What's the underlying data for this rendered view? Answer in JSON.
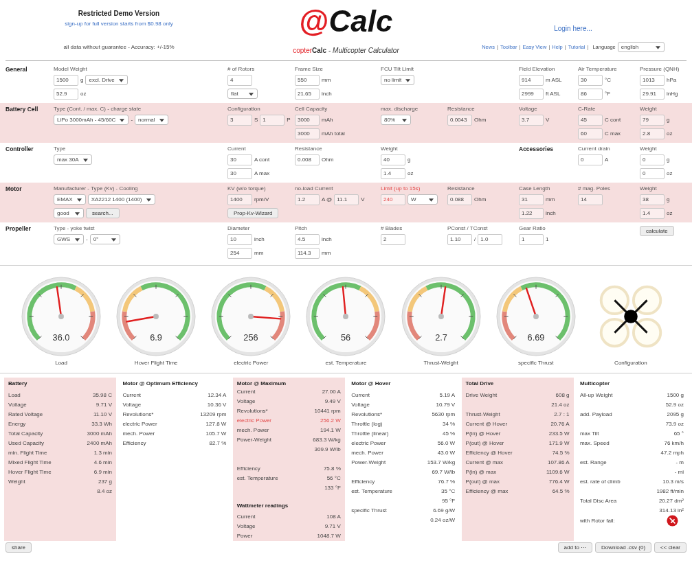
{
  "header": {
    "demo_title": "Restricted Demo Version",
    "signup": "sign-up for full version starts from $0.98 only",
    "disclaimer": "all data without guarantee - Accuracy: +/-15%",
    "logo_mark": "@",
    "logo_text": "Calc",
    "subtitle_prefix": "copter",
    "subtitle": "**Calc** - *Multicopter Calculator*",
    "login": "Login here...",
    "links": [
      "News",
      "Toolbar",
      "Easy View",
      "Help",
      "Tutorial"
    ],
    "separator": "|",
    "language_label": "Language",
    "language": "english"
  },
  "inputs": [
    {
      "title": "General",
      "shaded": false,
      "groups": [
        {
          "kind": "field",
          "label": "Model Weight",
          "lines": [
            [
              {
                "kind": "input",
                "text": "1500"
              },
              {
                "kind": "unit",
                "text": "g"
              },
              {
                "kind": "select",
                "text": "excl. Drive"
              }
            ],
            [
              {
                "kind": "input",
                "text": "52.9"
              },
              {
                "kind": "unit",
                "text": "oz"
              }
            ]
          ]
        },
        {
          "kind": "field",
          "label": "# of Rotors",
          "lines": [
            [
              {
                "kind": "input",
                "text": "4"
              }
            ],
            [
              {
                "kind": "select",
                "text": "flat"
              }
            ]
          ]
        },
        {
          "kind": "field",
          "label": "Frame Size",
          "lines": [
            [
              {
                "kind": "input",
                "text": "550"
              },
              {
                "kind": "unit",
                "text": "mm"
              }
            ],
            [
              {
                "kind": "input",
                "text": "21.65"
              },
              {
                "kind": "unit",
                "text": "inch"
              }
            ]
          ]
        },
        {
          "kind": "field",
          "label": "FCU Tilt Limit",
          "lines": [
            [
              {
                "kind": "select",
                "text": "no limit"
              }
            ]
          ]
        },
        {
          "kind": "field",
          "label": "Field Elevation",
          "lines": [
            [
              {
                "kind": "input",
                "text": "914"
              },
              {
                "kind": "unit",
                "text": "m ASL"
              }
            ],
            [
              {
                "kind": "input",
                "text": "2999"
              },
              {
                "kind": "unit",
                "text": "ft ASL"
              }
            ]
          ]
        },
        {
          "kind": "field",
          "label": "Air Temperature",
          "lines": [
            [
              {
                "kind": "input",
                "text": "30"
              },
              {
                "kind": "unit",
                "text": "°C"
              }
            ],
            [
              {
                "kind": "input",
                "text": "86"
              },
              {
                "kind": "unit",
                "text": "°F"
              }
            ]
          ]
        },
        {
          "kind": "field",
          "label": "Pressure (QNH)",
          "lines": [
            [
              {
                "kind": "input",
                "text": "1013"
              },
              {
                "kind": "unit",
                "text": "hPa"
              }
            ],
            [
              {
                "kind": "input",
                "text": "29.91"
              },
              {
                "kind": "unit",
                "text": "inHg"
              }
            ]
          ]
        }
      ]
    },
    {
      "title": "Battery Cell",
      "shaded": true,
      "groups": [
        {
          "kind": "field",
          "label": "Type (Cont. / max. C) - charge state",
          "lines": [
            [
              {
                "kind": "select",
                "text": "LiPo 3000mAh - 45/60C"
              },
              {
                "kind": "unit",
                "text": "-"
              },
              {
                "kind": "select",
                "text": "normal"
              }
            ]
          ]
        },
        {
          "kind": "field",
          "label": "Configuration",
          "lines": [
            [
              {
                "kind": "input",
                "text": "3"
              },
              {
                "kind": "unit",
                "text": "S"
              },
              {
                "kind": "input",
                "text": "1"
              },
              {
                "kind": "unit",
                "text": "P"
              }
            ]
          ]
        },
        {
          "kind": "field",
          "label": "Cell Capacity",
          "lines": [
            [
              {
                "kind": "input",
                "text": "3000"
              },
              {
                "kind": "unit",
                "text": "mAh"
              }
            ],
            [
              {
                "kind": "input",
                "text": "3000"
              },
              {
                "kind": "unit",
                "text": "mAh total"
              }
            ]
          ]
        },
        {
          "kind": "field",
          "label": "max. discharge",
          "lines": [
            [
              {
                "kind": "select",
                "text": "80%"
              }
            ]
          ]
        },
        {
          "kind": "field",
          "label": "Resistance",
          "lines": [
            [
              {
                "kind": "input",
                "text": "0.0043"
              },
              {
                "kind": "unit",
                "text": "Ohm"
              }
            ]
          ]
        },
        {
          "kind": "field",
          "label": "Voltage",
          "lines": [
            [
              {
                "kind": "input",
                "text": "3.7"
              },
              {
                "kind": "unit",
                "text": "V"
              }
            ]
          ]
        },
        {
          "kind": "field",
          "label": "C-Rate",
          "lines": [
            [
              {
                "kind": "input",
                "text": "45"
              },
              {
                "kind": "unit",
                "text": "C cont"
              }
            ],
            [
              {
                "kind": "input",
                "text": "60"
              },
              {
                "kind": "unit",
                "text": "C max"
              }
            ]
          ]
        },
        {
          "kind": "field",
          "label": "Weight",
          "lines": [
            [
              {
                "kind": "input",
                "text": "79"
              },
              {
                "kind": "unit",
                "text": "g"
              }
            ],
            [
              {
                "kind": "input",
                "text": "2.8"
              },
              {
                "kind": "unit",
                "text": "oz"
              }
            ]
          ]
        }
      ]
    },
    {
      "title": "Controller",
      "shaded": false,
      "groups": [
        {
          "kind": "field",
          "label": "Type",
          "lines": [
            [
              {
                "kind": "select",
                "text": "max 30A"
              }
            ]
          ]
        },
        {
          "kind": "field",
          "label": "Current",
          "lines": [
            [
              {
                "kind": "input",
                "text": "30"
              },
              {
                "kind": "unit",
                "text": "A cont"
              }
            ],
            [
              {
                "kind": "input",
                "text": "30"
              },
              {
                "kind": "unit",
                "text": "A max"
              }
            ]
          ]
        },
        {
          "kind": "field",
          "label": "Resistance",
          "lines": [
            [
              {
                "kind": "input",
                "text": "0.008"
              },
              {
                "kind": "unit",
                "text": "Ohm"
              }
            ]
          ]
        },
        {
          "kind": "field",
          "label": "Weight",
          "lines": [
            [
              {
                "kind": "input",
                "text": "40"
              },
              {
                "kind": "unit",
                "text": "g"
              }
            ],
            [
              {
                "kind": "input",
                "text": "1.4"
              },
              {
                "kind": "unit",
                "text": "oz"
              }
            ]
          ]
        },
        {
          "kind": "heading",
          "label": "Accessories"
        },
        {
          "kind": "field",
          "label": "Current drain",
          "lines": [
            [
              {
                "kind": "input",
                "text": "0"
              },
              {
                "kind": "unit",
                "text": "A"
              }
            ]
          ]
        },
        {
          "kind": "field",
          "label": "Weight",
          "lines": [
            [
              {
                "kind": "input",
                "text": "0"
              },
              {
                "kind": "unit",
                "text": "g"
              }
            ],
            [
              {
                "kind": "input",
                "text": "0"
              },
              {
                "kind": "unit",
                "text": "oz"
              }
            ]
          ]
        }
      ]
    },
    {
      "title": "Motor",
      "shaded": true,
      "groups": [
        {
          "kind": "field",
          "label": "Manufacturer - Type (Kv) - Cooling",
          "lines": [
            [
              {
                "kind": "select",
                "text": "EMAX"
              },
              {
                "kind": "select",
                "text": "XA2212 1400 (1400)"
              }
            ],
            [
              {
                "kind": "select",
                "text": "good"
              },
              {
                "kind": "button",
                "text": "search..."
              }
            ]
          ]
        },
        {
          "kind": "field",
          "label": "KV (w/o torque)",
          "lines": [
            [
              {
                "kind": "input",
                "text": "1400"
              },
              {
                "kind": "unit",
                "text": "rpm/V"
              }
            ],
            [
              {
                "kind": "button",
                "text": "Prop-Kv-Wizard"
              }
            ]
          ]
        },
        {
          "kind": "field",
          "label": "no-load Current",
          "lines": [
            [
              {
                "kind": "input",
                "text": "1.2"
              },
              {
                "kind": "unit",
                "text": "A @"
              },
              {
                "kind": "input",
                "text": "11.1"
              },
              {
                "kind": "unit",
                "text": "V"
              }
            ]
          ]
        },
        {
          "kind": "alert",
          "label": "Limit (up to 15s)",
          "lines": [
            [
              {
                "kind": "input",
                "text": "240"
              },
              {
                "kind": "select",
                "text": "W"
              }
            ]
          ]
        },
        {
          "kind": "field",
          "label": "Resistance",
          "lines": [
            [
              {
                "kind": "input",
                "text": "0.088"
              },
              {
                "kind": "unit",
                "text": "Ohm"
              }
            ]
          ]
        },
        {
          "kind": "field",
          "label": "Case Length",
          "lines": [
            [
              {
                "kind": "input",
                "text": "31"
              },
              {
                "kind": "unit",
                "text": "mm"
              }
            ],
            [
              {
                "kind": "input",
                "text": "1.22"
              },
              {
                "kind": "unit",
                "text": "inch"
              }
            ]
          ]
        },
        {
          "kind": "field",
          "label": "# mag. Poles",
          "lines": [
            [
              {
                "kind": "input",
                "text": "14"
              }
            ]
          ]
        },
        {
          "kind": "field",
          "label": "Weight",
          "lines": [
            [
              {
                "kind": "input",
                "text": "38"
              },
              {
                "kind": "unit",
                "text": "g"
              }
            ],
            [
              {
                "kind": "input",
                "text": "1.4"
              },
              {
                "kind": "unit",
                "text": "oz"
              }
            ]
          ]
        }
      ]
    },
    {
      "title": "Propeller",
      "shaded": false,
      "groups": [
        {
          "kind": "field",
          "label": "Type - yoke twist",
          "lines": [
            [
              {
                "kind": "select",
                "text": "GWS"
              },
              {
                "kind": "unit",
                "text": "-"
              },
              {
                "kind": "select",
                "text": "0°"
              }
            ]
          ]
        },
        {
          "kind": "field",
          "label": "Diameter",
          "lines": [
            [
              {
                "kind": "input",
                "text": "10"
              },
              {
                "kind": "unit",
                "text": "inch"
              }
            ],
            [
              {
                "kind": "input",
                "text": "254"
              },
              {
                "kind": "unit",
                "text": "mm"
              }
            ]
          ]
        },
        {
          "kind": "field",
          "label": "Pitch",
          "lines": [
            [
              {
                "kind": "input",
                "text": "4.5"
              },
              {
                "kind": "unit",
                "text": "inch"
              }
            ],
            [
              {
                "kind": "input",
                "text": "114.3"
              },
              {
                "kind": "unit",
                "text": "mm"
              }
            ]
          ]
        },
        {
          "kind": "field",
          "label": "# Blades",
          "lines": [
            [
              {
                "kind": "input",
                "text": "2"
              }
            ]
          ]
        },
        {
          "kind": "field",
          "label": "PConst / TConst",
          "lines": [
            [
              {
                "kind": "input",
                "text": "1.10"
              },
              {
                "kind": "unit",
                "text": "/"
              },
              {
                "kind": "input",
                "text": "1.0"
              }
            ]
          ]
        },
        {
          "kind": "field",
          "label": "Gear Ratio",
          "lines": [
            [
              {
                "kind": "input",
                "text": "1"
              },
              {
                "kind": "unit",
                "text": "1"
              }
            ]
          ]
        },
        {
          "kind": "field",
          "lines": [
            [
              {
                "kind": "button",
                "text": "calculate"
              }
            ]
          ]
        }
      ]
    }
  ],
  "gauges": [
    {
      "kind": "gauge",
      "label": "Load",
      "value": "36.0"
    },
    {
      "kind": "gauge",
      "label": "Hover Flight Time",
      "value": "6.9"
    },
    {
      "kind": "gauge",
      "label": "electric Power",
      "value": "256"
    },
    {
      "kind": "gauge",
      "label": "est. Temperature",
      "value": "56"
    },
    {
      "kind": "gauge",
      "label": "Thrust-Weight",
      "value": "2.7"
    },
    {
      "kind": "gauge",
      "label": "specific Thrust",
      "value": "6.69"
    },
    {
      "kind": "configuration",
      "label": "Configuration"
    }
  ],
  "results": [
    {
      "title": "Battery",
      "shaded": true,
      "rows": [
        {
          "kind": "row",
          "label": "Load",
          "value": "35.98 C"
        },
        {
          "kind": "row",
          "label": "Voltage",
          "value": "9.71 V"
        },
        {
          "kind": "row",
          "label": "Rated Voltage",
          "value": "11.10 V"
        },
        {
          "kind": "row",
          "label": "Energy",
          "value": "33.3 Wh"
        },
        {
          "kind": "row",
          "label": "Total Capacity",
          "value": "3000 mAh"
        },
        {
          "kind": "row",
          "label": "Used Capacity",
          "value": "2400 mAh"
        },
        {
          "kind": "row",
          "label": "min. Flight Time",
          "value": "1.3 min"
        },
        {
          "kind": "row",
          "label": "Mixed Flight Time",
          "value": "4.6 min"
        },
        {
          "kind": "row",
          "label": "Hover Flight Time",
          "value": "6.9 min"
        },
        {
          "kind": "row",
          "label": "Weight",
          "value": "237 g"
        },
        {
          "kind": "row",
          "value": "8.4 oz"
        }
      ]
    },
    {
      "title": "Motor @ Optimum Efficiency",
      "shaded": false,
      "rows": [
        {
          "kind": "row",
          "label": "Current",
          "value": "12.34 A"
        },
        {
          "kind": "row",
          "label": "Voltage",
          "value": "10.36 V"
        },
        {
          "kind": "row",
          "label": "Revolutions*",
          "value": "13209 rpm"
        },
        {
          "kind": "row",
          "label": "electric Power",
          "value": "127.8 W"
        },
        {
          "kind": "row",
          "label": "mech. Power",
          "value": "105.7 W"
        },
        {
          "kind": "row",
          "label": "Efficiency",
          "value": "82.7 %"
        }
      ]
    },
    {
      "title": "Motor @ Maximum",
      "shaded": true,
      "rows": [
        {
          "kind": "row",
          "label": "Current",
          "value": "27.00 A"
        },
        {
          "kind": "row",
          "label": "Voltage",
          "value": "9.49 V"
        },
        {
          "kind": "row",
          "label": "Revolutions*",
          "value": "10441 rpm"
        },
        {
          "kind": "alert",
          "label": "electric Power",
          "value": "256.2 W"
        },
        {
          "kind": "row",
          "label": "mech. Power",
          "value": "194.1 W"
        },
        {
          "kind": "row",
          "label": "Power-Weight",
          "value": "683.3 W/kg"
        },
        {
          "kind": "row",
          "value": "309.9 W/lb"
        },
        {
          "kind": "gap"
        },
        {
          "kind": "row",
          "label": "Efficiency",
          "value": "75.8 %"
        },
        {
          "kind": "row",
          "label": "est. Temperature",
          "value": "56 °C"
        },
        {
          "kind": "row",
          "value": "133 °F"
        },
        {
          "kind": "gap"
        },
        {
          "kind": "heading",
          "label": "Wattmeter readings"
        },
        {
          "kind": "row",
          "label": "Current",
          "value": "108 A"
        },
        {
          "kind": "row",
          "label": "Voltage",
          "value": "9.71 V"
        },
        {
          "kind": "row",
          "label": "Power",
          "value": "1048.7 W"
        }
      ]
    },
    {
      "title": "Motor @ Hover",
      "shaded": false,
      "rows": [
        {
          "kind": "row",
          "label": "Current",
          "value": "5.19 A"
        },
        {
          "kind": "row",
          "label": "Voltage",
          "value": "10.79 V"
        },
        {
          "kind": "row",
          "label": "Revolutions*",
          "value": "5630 rpm"
        },
        {
          "kind": "row",
          "label": "Throttle (log)",
          "value": "34 %"
        },
        {
          "kind": "row",
          "label": "Throttle (linear)",
          "value": "45 %"
        },
        {
          "kind": "row",
          "label": "electric Power",
          "value": "56.0 W"
        },
        {
          "kind": "row",
          "label": "mech. Power",
          "value": "43.0 W"
        },
        {
          "kind": "row",
          "label": "Power-Weight",
          "value": "153.7 W/kg"
        },
        {
          "kind": "row",
          "value": "69.7 W/lb"
        },
        {
          "kind": "row",
          "label": "Efficiency",
          "value": "76.7 %"
        },
        {
          "kind": "row",
          "label": "est. Temperature",
          "value": "35 °C"
        },
        {
          "kind": "row",
          "value": "95 °F"
        },
        {
          "kind": "row",
          "label": "specific Thrust",
          "value": "6.69 g/W"
        },
        {
          "kind": "row",
          "value": "0.24 oz/W"
        }
      ]
    },
    {
      "title": "Total Drive",
      "shaded": true,
      "rows": [
        {
          "kind": "row",
          "label": "Drive Weight",
          "value": "608 g"
        },
        {
          "kind": "row",
          "value": "21.4 oz"
        },
        {
          "kind": "row",
          "label": "Thrust-Weight",
          "value": "2.7 : 1"
        },
        {
          "kind": "row",
          "label": "Current @ Hover",
          "value": "20.76 A"
        },
        {
          "kind": "row",
          "label": "P(in) @ Hover",
          "value": "233.5 W"
        },
        {
          "kind": "row",
          "label": "P(out) @ Hover",
          "value": "171.9 W"
        },
        {
          "kind": "row",
          "label": "Efficiency @ Hover",
          "value": "74.5 %"
        },
        {
          "kind": "row",
          "label": "Current @ max",
          "value": "107.86 A"
        },
        {
          "kind": "row",
          "label": "P(in) @ max",
          "value": "1109.6 W"
        },
        {
          "kind": "row",
          "label": "P(out) @ max",
          "value": "776.4 W"
        },
        {
          "kind": "row",
          "label": "Efficiency @ max",
          "value": "64.5 %"
        }
      ]
    },
    {
      "title": "Multicopter",
      "shaded": false,
      "rows": [
        {
          "kind": "row",
          "label": "All-up Weight",
          "value": "1500 g"
        },
        {
          "kind": "row",
          "value": "52.9 oz"
        },
        {
          "kind": "row",
          "label": "add. Payload",
          "value": "2095 g"
        },
        {
          "kind": "row",
          "value": "73.9 oz"
        },
        {
          "kind": "row",
          "label": "max Tilt",
          "value": "65 °"
        },
        {
          "kind": "row",
          "label": "max. Speed",
          "value": "76 km/h"
        },
        {
          "kind": "row",
          "value": "47.2 mph"
        },
        {
          "kind": "row",
          "label": "est. Range",
          "value": "- m"
        },
        {
          "kind": "row",
          "value": "- mi"
        },
        {
          "kind": "row",
          "label": "est. rate of climb",
          "value": "10.3 m/s"
        },
        {
          "kind": "row",
          "value": "1982 ft/min"
        },
        {
          "kind": "row",
          "label": "Total Disc Area",
          "value": "20.27 dm²"
        },
        {
          "kind": "row",
          "value": "314.13 in²"
        },
        {
          "kind": "status",
          "label": "with Rotor fail:"
        }
      ]
    }
  ],
  "footer": {
    "share": "share",
    "actions": [
      "add to ···",
      "Download .csv (0)",
      "<< clear"
    ]
  }
}
